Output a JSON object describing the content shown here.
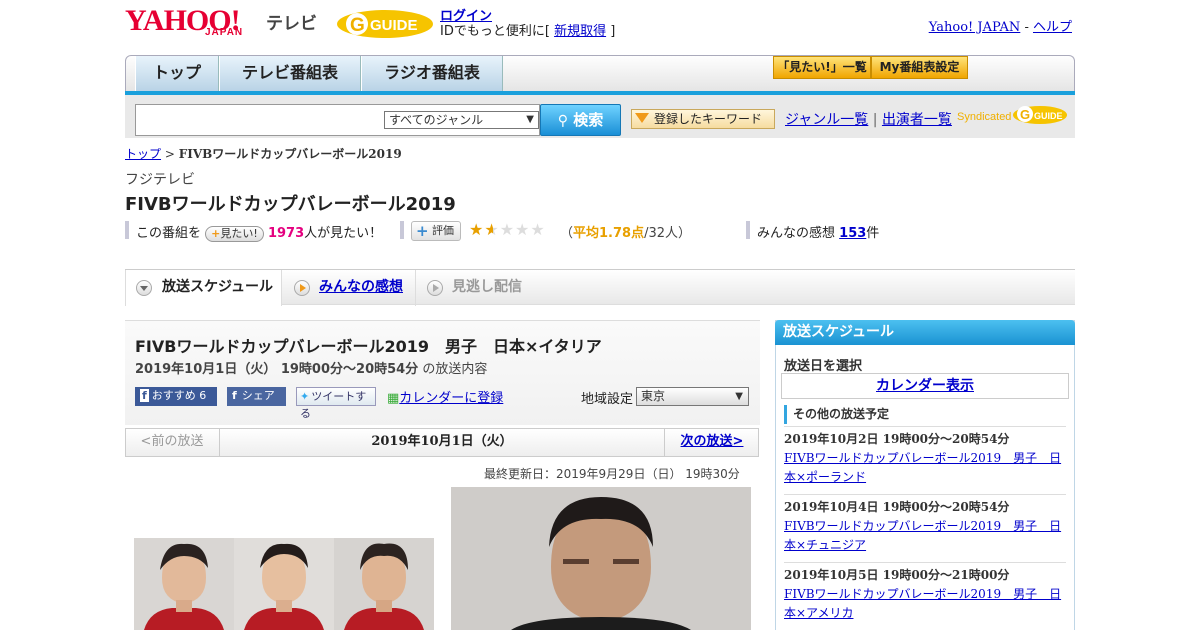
{
  "header": {
    "yahoo_logo": "YAHOO!",
    "japan_logo": "JAPAN",
    "tv_logo": "テレビ",
    "gguide_logo": "G-GUIDE",
    "login": "ログイン",
    "id_text_prefix": "IDでもっと便利に[ ",
    "register": "新規取得",
    "id_text_suffix": " ]",
    "yahoo_japan_link": "Yahoo! JAPAN",
    "separator": " - ",
    "help_link": "ヘルプ"
  },
  "nav": {
    "tabs": [
      "トップ",
      "テレビ番組表",
      "ラジオ番組表"
    ],
    "want_list": "「見たい!」一覧",
    "my_schedule": "My番組表設定"
  },
  "search": {
    "genre_selected": "すべてのジャンル",
    "button": "検索",
    "keyword_button": "登録したキーワード",
    "genre_list": "ジャンル一覧",
    "pipe": "|",
    "performer_list": "出演者一覧",
    "syndicated": "Syndicated"
  },
  "breadcrumb": {
    "top": "トップ",
    "sep": " > ",
    "current": "FIVBワールドカップバレーボール2019"
  },
  "program": {
    "station": "フジテレビ",
    "title": "FIVBワールドカップバレーボール2019",
    "want_prefix": "この番組を",
    "want_pill": "見たい!",
    "want_count": "1973",
    "want_suffix": "人が見たい！",
    "rate_label": "評価",
    "rating_stars": 1.78,
    "avg_open": "（",
    "avg_label": "平均1.78点",
    "avg_count": "/32人）",
    "kansou_prefix": "みんなの感想",
    "kansou_count": "153",
    "kansou_suffix": "件"
  },
  "tabs": {
    "schedule": "放送スケジュール",
    "reviews": "みんなの感想",
    "missed": "見逃し配信"
  },
  "episode": {
    "title": "FIVBワールドカップバレーボール2019　男子　日本×イタリア",
    "date": "2019年10月1日（火） 19時00分～20時54分",
    "date_suffix": " の放送内容",
    "recommend": "おすすめ 6",
    "share": "シェア",
    "tweet": "ツイートする",
    "calendar": "カレンダーに登録",
    "region_label": "地域設定",
    "region_value": "東京",
    "prev": "<前の放送",
    "current_date": "2019年10月1日（火）",
    "next": "次の放送>",
    "updated": "最終更新日：2019年9月29日（日） 19時30分"
  },
  "sidebar": {
    "header": "放送スケジュール",
    "select_date": "放送日を選択",
    "calendar": "カレンダー表示",
    "other_header": "その他の放送予定",
    "items": [
      {
        "date": "2019年10月2日 19時00分～20時54分",
        "title": "FIVBワールドカップバレーボール2019　男子　日本×ポーランド"
      },
      {
        "date": "2019年10月4日 19時00分～20時54分",
        "title": "FIVBワールドカップバレーボール2019　男子　日本×チュニジア"
      },
      {
        "date": "2019年10月5日 19時00分～21時00分",
        "title": "FIVBワールドカップバレーボール2019　男子　日本×アメリカ"
      }
    ]
  },
  "colors": {
    "accent": "#1aa0dc",
    "yahoo_red": "#e60033",
    "want_count": "#e4007f",
    "rating": "#e8a000"
  }
}
